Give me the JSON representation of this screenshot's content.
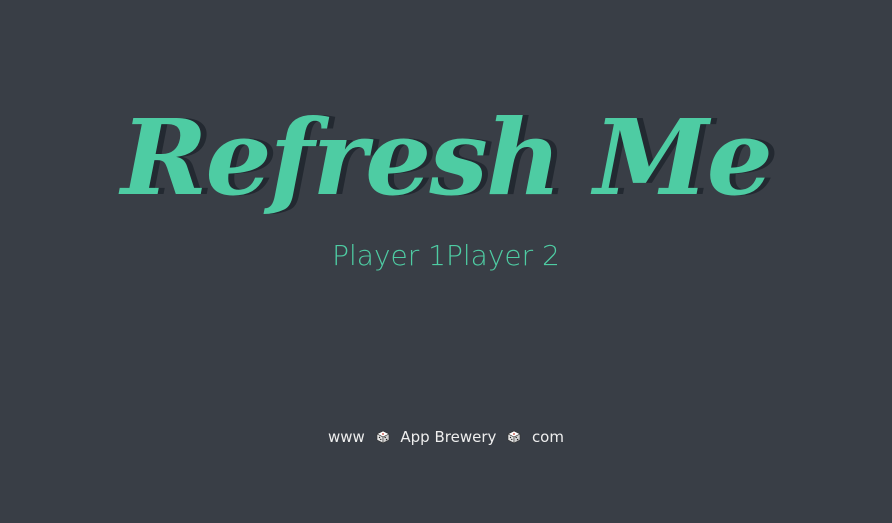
{
  "page": {
    "title": "Refresh Me",
    "players": {
      "player1": "Player 1",
      "player2": "Player 2"
    },
    "footer": {
      "www": "www",
      "brand": "App Brewery",
      "com": "com",
      "separator_icon": "dice-icon"
    }
  },
  "colors": {
    "background": "#393e46",
    "accent": "#4ecca3",
    "title_shadow": "#232931",
    "footer_text": "#eeeeee"
  }
}
